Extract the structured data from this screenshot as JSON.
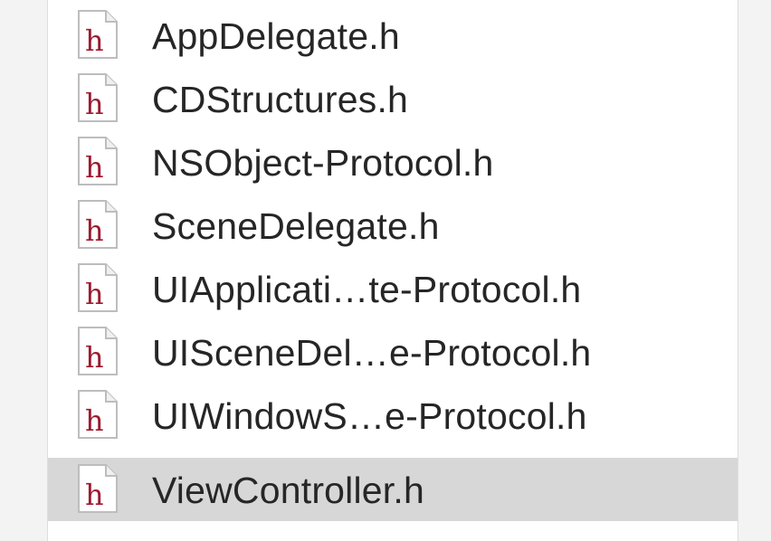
{
  "file_navigator": {
    "items": [
      {
        "name": "AppDelegate.h",
        "icon": "header-file-icon",
        "selected": false
      },
      {
        "name": "CDStructures.h",
        "icon": "header-file-icon",
        "selected": false
      },
      {
        "name": "NSObject-Protocol.h",
        "icon": "header-file-icon",
        "selected": false
      },
      {
        "name": "SceneDelegate.h",
        "icon": "header-file-icon",
        "selected": false
      },
      {
        "name": "UIApplicati…te-Protocol.h",
        "icon": "header-file-icon",
        "selected": false
      },
      {
        "name": "UISceneDel…e-Protocol.h",
        "icon": "header-file-icon",
        "selected": false
      },
      {
        "name": "UIWindowS…e-Protocol.h",
        "icon": "header-file-icon",
        "selected": false
      },
      {
        "name": "ViewController.h",
        "icon": "header-file-icon",
        "selected": true
      }
    ],
    "icon_letter": "h",
    "colors": {
      "icon_letter": "#9b1b30",
      "selected_row": "#d7d7d7",
      "text": "#262626"
    }
  }
}
